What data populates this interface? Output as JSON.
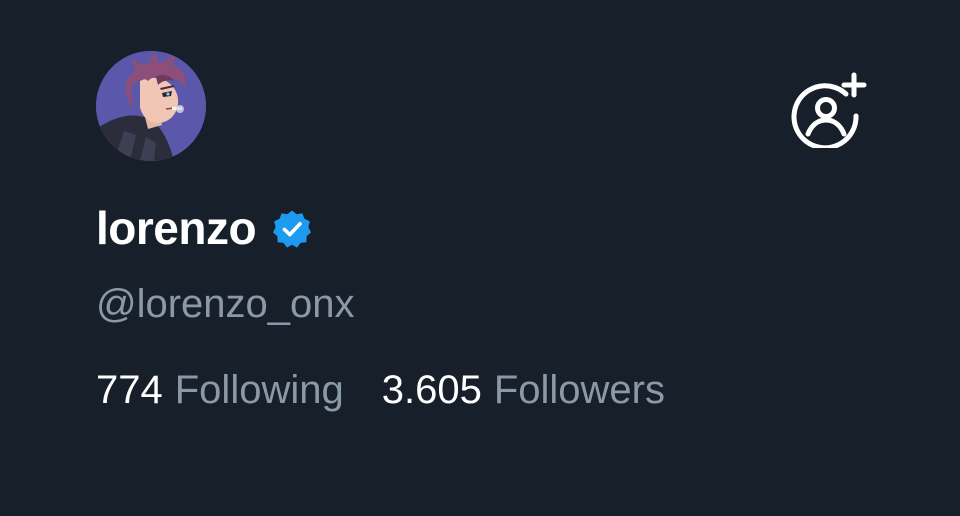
{
  "profile": {
    "display_name": "lorenzo",
    "handle": "@lorenzo_onx",
    "verified": true,
    "avatar_icon": "anime-avatar"
  },
  "actions": {
    "follow_icon": "add-user-icon"
  },
  "stats": {
    "following_count": "774",
    "following_label": "Following",
    "followers_count": "3.605",
    "followers_label": "Followers"
  },
  "colors": {
    "background": "#17202a",
    "primary_text": "#ffffff",
    "secondary_text": "#8b98a5",
    "verified_badge": "#1d9bf0"
  }
}
